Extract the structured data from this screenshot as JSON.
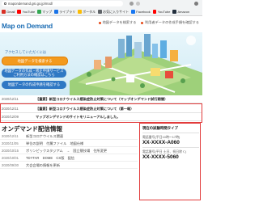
{
  "browser": {
    "url": "mapondemand.gsi.go.jp/mod/",
    "bookmarks": [
      {
        "label": "Gmail",
        "color": "#d93025"
      },
      {
        "label": "YouTube",
        "color": "#ff0000"
      },
      {
        "label": "マップ",
        "color": "#34a853"
      },
      {
        "label": "ライブラリ",
        "color": "#1a73e8"
      },
      {
        "label": "ポータル",
        "color": "#fbbc04"
      },
      {
        "label": "お気に入りサイト",
        "color": "#5f6368"
      },
      {
        "label": "Facebook",
        "color": "#1877f2"
      },
      {
        "label": "YouTube",
        "color": "#ff0000"
      },
      {
        "label": "Amazon",
        "color": "#232f3e"
      }
    ]
  },
  "header": {
    "logo": "Map on Demand",
    "links": [
      "地図データを検索する",
      "利用者データの作成手順を確認する"
    ]
  },
  "hero": {
    "label": "アクセスしていただくには",
    "cta_primary": "地図データを検索する",
    "cta_secondary_line1": "地図データの作成・修正申請サービス",
    "cta_secondary_line2": "ご利用方法の確認はこちら",
    "cta_tertiary": "地図データの作成申請を確認する"
  },
  "news": [
    {
      "date": "2020/12/11",
      "text": "【重要】新型コロナウイルス感染症防止対策について（マップオンデマンド試行期間）"
    },
    {
      "date": "2020/12/11",
      "text": "【重要】新型コロナウイルス感染症防止対策について（第一報）"
    },
    {
      "date": "2020/12/09",
      "text": "マップオンデマンドのサイトをリニューアルしました。"
    }
  ],
  "section": {
    "title": "オンデマンド配信情報",
    "rows": [
      {
        "date": "2020/12/11",
        "text": "新型コロナウイルス関連"
      },
      {
        "date": "2020/11/05",
        "text": "単位の説明　付属ファイル　地図仕様"
      },
      {
        "date": "2020/10/15",
        "text": "ポリンピックスタジアム　→　国立競技場　住所変更"
      },
      {
        "date": "2020/10/01",
        "text": "TDYTAR　DOME　CS版　配信"
      },
      {
        "date": "2020/09/30",
        "text": "大会会場の情報を更新"
      }
    ]
  },
  "contact": {
    "title": "現在の試験時間タイプ",
    "sub1": "電話番号(平日10時～17時)",
    "tel1": "XX-XXXX-A060",
    "sub2": "電話番号(平日 土日、祝日除く)",
    "tel2": "XX-XXXX-5060"
  },
  "colors": {
    "brand": "#1f6fb5",
    "cta_orange": "#f39a1e",
    "cta_blue": "#2f78c4",
    "highlight_border": "#e23b3b"
  }
}
